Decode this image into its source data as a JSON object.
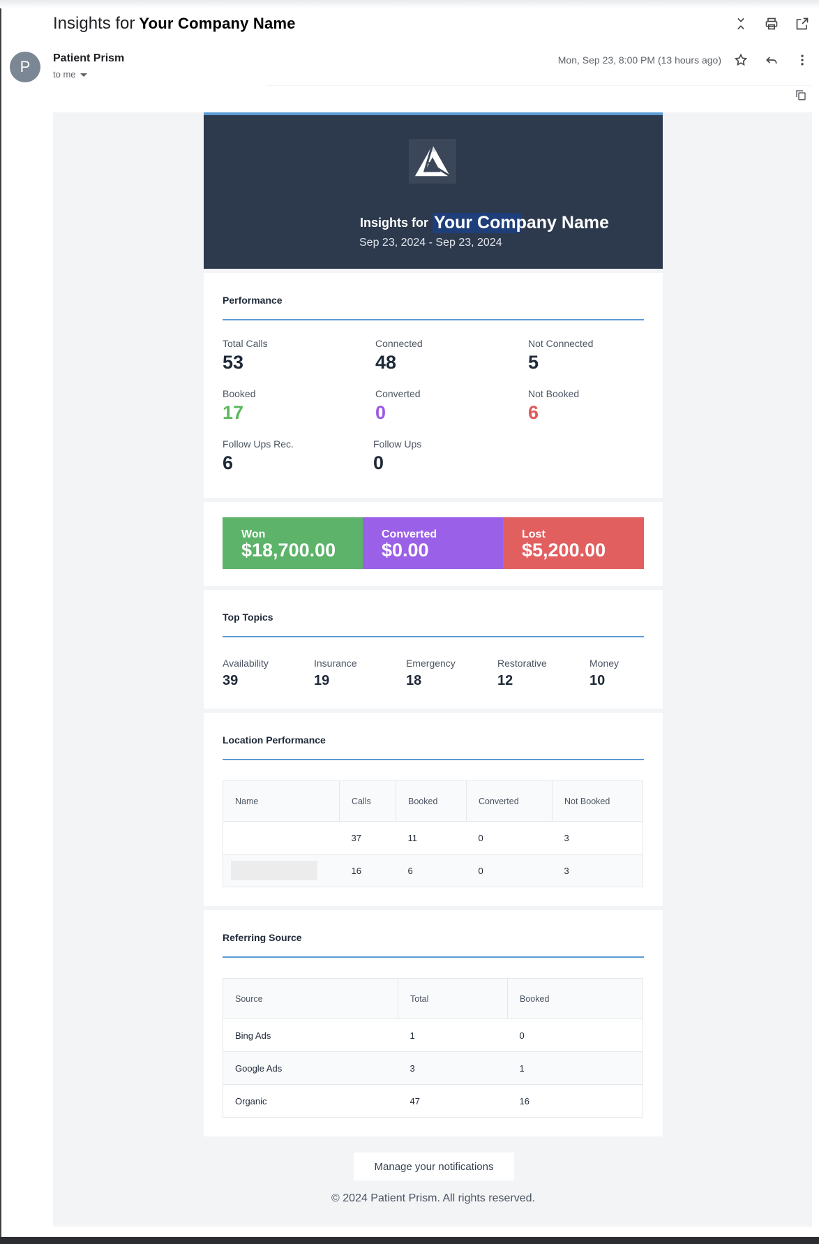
{
  "email": {
    "subject_prefix": "Insights for",
    "subject_company": "Your Company Name",
    "sender_initial": "P",
    "sender_name": "Patient Prism",
    "recipient": "to me",
    "datetime": "Mon, Sep 23, 8:00 PM (13 hours ago)"
  },
  "icons": {
    "top": [
      "expand-collapse-icon",
      "print-icon",
      "open-in-new-window-icon"
    ],
    "message": [
      "star-icon",
      "reply-icon",
      "more-vert-icon"
    ],
    "copy": "copy-icon",
    "logo": "patient-prism-logo"
  },
  "header": {
    "insights_for": "Insights for",
    "company": "Your Company Name",
    "date_range": "Sep 23, 2024 - Sep 23, 2024"
  },
  "performance": {
    "title": "Performance",
    "stats": [
      {
        "label": "Total Calls",
        "value": "53",
        "color": "#1f2937"
      },
      {
        "label": "Connected",
        "value": "48",
        "color": "#1f2937"
      },
      {
        "label": "Not Connected",
        "value": "5",
        "color": "#1f2937"
      },
      {
        "label": "Booked",
        "value": "17",
        "color": "#5cb85c"
      },
      {
        "label": "Converted",
        "value": "0",
        "color": "#9b59e6"
      },
      {
        "label": "Not Booked",
        "value": "6",
        "color": "#e05a5a"
      },
      {
        "label": "Follow Ups Rec.",
        "value": "6",
        "color": "#1f2937"
      },
      {
        "label": "Follow Ups",
        "value": "0",
        "color": "#1f2937"
      }
    ]
  },
  "money": [
    {
      "label": "Won",
      "value": "$18,700.00",
      "color": "#5cb369"
    },
    {
      "label": "Converted",
      "value": "$0.00",
      "color": "#9b60e8"
    },
    {
      "label": "Lost",
      "value": "$5,200.00",
      "color": "#e25f60"
    }
  ],
  "topics": {
    "title": "Top Topics",
    "items": [
      {
        "label": "Availability",
        "value": "39"
      },
      {
        "label": "Insurance",
        "value": "19"
      },
      {
        "label": "Emergency",
        "value": "18"
      },
      {
        "label": "Restorative",
        "value": "12"
      },
      {
        "label": "Money",
        "value": "10"
      }
    ]
  },
  "location": {
    "title": "Location Performance",
    "headers": [
      "Name",
      "Calls",
      "Booked",
      "Converted",
      "Not Booked"
    ],
    "rows": [
      [
        "",
        "37",
        "11",
        "0",
        "3"
      ],
      [
        "",
        "16",
        "6",
        "0",
        "3"
      ]
    ]
  },
  "referring": {
    "title": "Referring Source",
    "headers": [
      "Source",
      "Total",
      "Booked"
    ],
    "rows": [
      [
        "Bing Ads",
        "1",
        "0"
      ],
      [
        "Google Ads",
        "3",
        "1"
      ],
      [
        "Organic",
        "47",
        "16"
      ]
    ]
  },
  "footer": {
    "manage": "Manage your notifications",
    "copyright": "© 2024 Patient Prism. All rights reserved."
  }
}
